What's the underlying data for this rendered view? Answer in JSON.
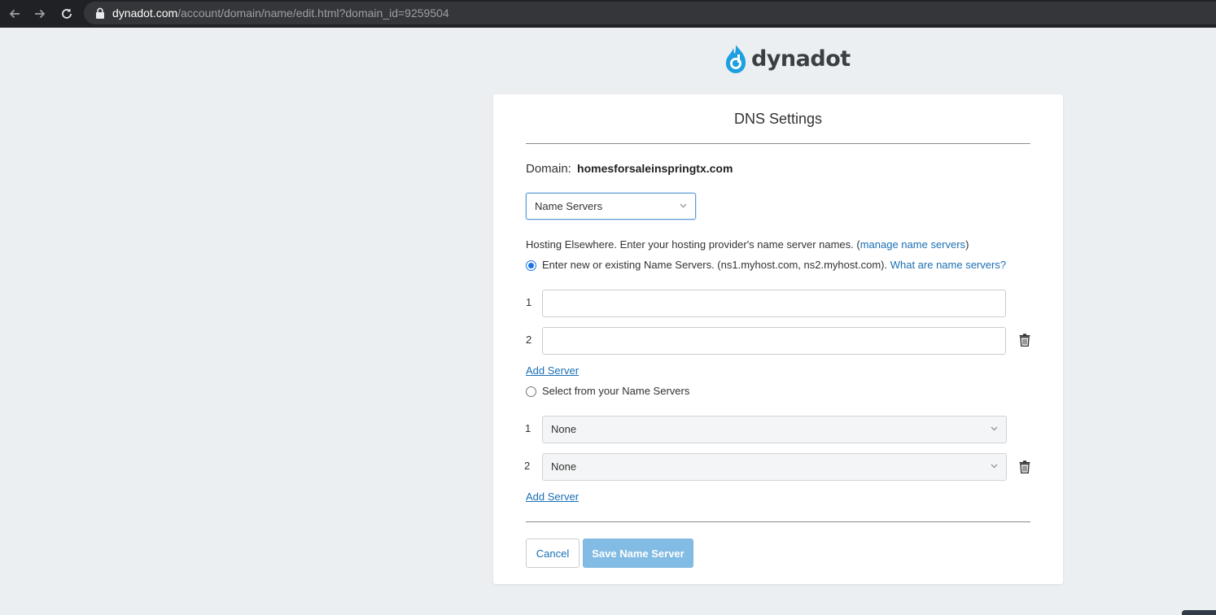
{
  "browser": {
    "url_host": "dynadot.com",
    "url_path": "/account/domain/name/edit.html?domain_id=9259504"
  },
  "brand": {
    "name": "dynadot",
    "accent": "#1ea0e0"
  },
  "card": {
    "title": "DNS Settings",
    "domain_label": "Domain:",
    "domain_value": "homesforsaleinspringtx.com",
    "record_type": "Name Servers",
    "hint_text": "Hosting Elsewhere. Enter your hosting provider's name server names. (",
    "hint_link": "manage name servers",
    "hint_close": ")",
    "option_enter": {
      "label": "Enter new or existing Name Servers. (ns1.myhost.com, ns2.myhost.com).",
      "link": "What are name servers?",
      "checked": true
    },
    "entered_servers": [
      {
        "num": "1",
        "value": ""
      },
      {
        "num": "2",
        "value": ""
      }
    ],
    "add_server_label": "Add Server",
    "option_select": {
      "label": "Select from your Name Servers",
      "checked": false
    },
    "selected_servers": [
      {
        "num": "1",
        "value": "None"
      },
      {
        "num": "2",
        "value": "None"
      }
    ],
    "add_server_label_2": "Add Server",
    "cancel_label": "Cancel",
    "save_label": "Save Name Server"
  }
}
